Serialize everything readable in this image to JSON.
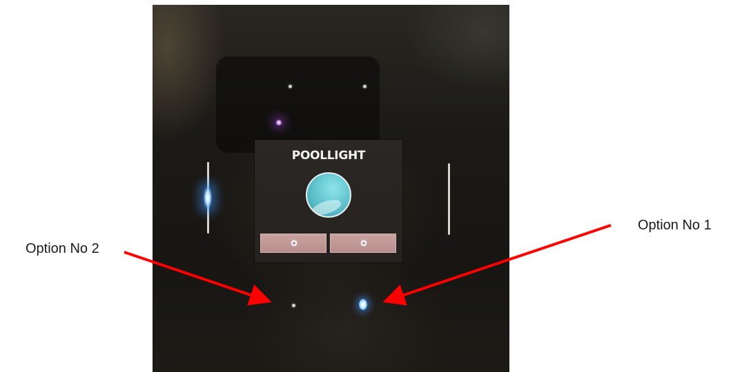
{
  "device_screen": {
    "title": "POOLLIGHT",
    "light_icon": "pool-light-circle-icon",
    "buttons": [
      {
        "icon": "dot-icon"
      },
      {
        "icon": "dot-icon"
      }
    ]
  },
  "annotations": {
    "option2_label": "Option No 2",
    "option1_label": "Option No 1",
    "arrow_color": "#ff0000"
  },
  "colors": {
    "screen_accent": "#63c6cf",
    "button_fill": "#c9a3a1",
    "led_active": "#6db9ff"
  }
}
